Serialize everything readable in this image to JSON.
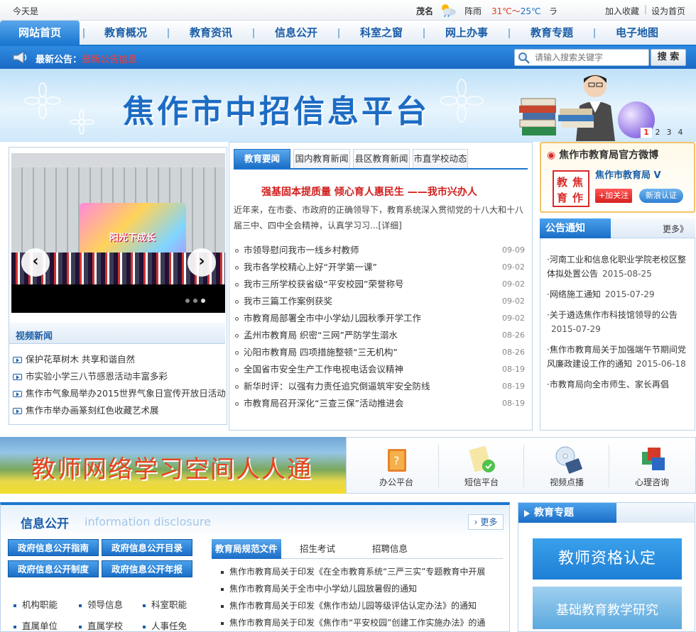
{
  "topbar": {
    "today": "今天是",
    "city": "茂名",
    "weather_icon": "partly-cloudy-icon",
    "weather_desc": "阵雨",
    "temp_hi": "31℃",
    "temp_sep": "～",
    "temp_lo": "25℃",
    "more": "ラ",
    "add_fav": "加入收藏",
    "sep": "|",
    "set_home": "设为首页"
  },
  "nav": {
    "items": [
      "网站首页",
      "教育概况",
      "教育资讯",
      "信息公开",
      "科室之窗",
      "网上办事",
      "教育专题",
      "电子地图"
    ]
  },
  "notice": {
    "label": "最新公告：",
    "value": "最新公告信息",
    "search_placeholder": "请输入搜索关键字",
    "search_button": "搜 索"
  },
  "banner": {
    "title": "焦作市中招信息平台",
    "pages": [
      "1",
      "2",
      "3",
      "4"
    ]
  },
  "slideshow": {
    "stage_text": "阳光下成长",
    "prev": "‹",
    "next": "›"
  },
  "video_news": {
    "title": "视频新闻",
    "items": [
      "保护花草树木 共享和谐自然",
      "市实验小学三八节感恩活动丰富多彩",
      "焦作市气象局举办2015世界气象日宣传开放日活动",
      "焦作市举办画篆刻红色收藏艺术展"
    ]
  },
  "news_tabs": [
    "教育要闻",
    "国内教育新闻",
    "县区教育新闻",
    "市直学校动态"
  ],
  "headline": "强基固本提质量 倾心育人惠民生 ——我市兴办人",
  "summary": "近年来，在市委、市政府的正确领导下，教育系统深入贯彻党的十八大和十八届三中、四中全会精神，认真学习习...[详细]",
  "news": [
    {
      "title": "市领导慰问我市一线乡村教师",
      "date": "09-09"
    },
    {
      "title": "我市各学校精心上好“开学第一课”",
      "date": "09-02"
    },
    {
      "title": "我市三所学校获省级“平安校园”荣誉称号",
      "date": "09-02"
    },
    {
      "title": "我市三篇工作案例获奖",
      "date": "09-02"
    },
    {
      "title": "市教育局部署全市中小学幼儿园秋季开学工作",
      "date": "09-02"
    },
    {
      "title": "孟州市教育局 织密“三网”严防学生溺水",
      "date": "08-26"
    },
    {
      "title": "沁阳市教育局 四项措施整顿“三无机构”",
      "date": "08-26"
    },
    {
      "title": "全国省市安全生产工作电视电话会议精神",
      "date": "08-19"
    },
    {
      "title": "新华时评：以强有力责任追究倒逼筑牢安全防线",
      "date": "08-19"
    },
    {
      "title": "市教育局召开深化“三查三保”活动推进会",
      "date": "08-19"
    }
  ],
  "weibo": {
    "header": "焦作市教育局官方微博",
    "logo_chars": [
      "教",
      "焦",
      "育",
      "作"
    ],
    "account": "焦作市教育局 V",
    "follow": "+加关注",
    "verify": "新浪认证"
  },
  "notices": {
    "title": "公告通知",
    "more": "更多》",
    "items": [
      {
        "text": "·河南工业和信息化职业学院老校区整体拟处置公告",
        "date": "2015-08-25"
      },
      {
        "text": "·网络施工通知",
        "date": "2015-07-29"
      },
      {
        "text": "·关于遴选焦作市科技馆领导的公告",
        "date": "2015-07-29"
      },
      {
        "text": "·焦作市教育局关于加强端午节期间党风廉政建设工作的通知",
        "date": "2015-06-18"
      },
      {
        "text": "·市教育局向全市师生、家长再倡",
        "date": ""
      }
    ]
  },
  "ad": {
    "text": "教师网络学习空间人人通"
  },
  "services": [
    {
      "label": "办公平台",
      "icon": "office-book-icon"
    },
    {
      "label": "短信平台",
      "icon": "sms-platform-icon"
    },
    {
      "label": "视频点播",
      "icon": "video-disc-icon"
    },
    {
      "label": "心理咨询",
      "icon": "psychology-icon"
    }
  ],
  "info": {
    "title_cn": "信息公开",
    "title_en": "information disclosure",
    "more": "更多",
    "buttons": [
      "政府信息公开指南",
      "政府信息公开目录",
      "政府信息公开制度",
      "政府信息公开年报"
    ],
    "links": [
      "机构职能",
      "领导信息",
      "科室职能",
      "直属单位",
      "直属学校",
      "人事任免"
    ],
    "tabs": [
      "教育局规范文件",
      "招生考试",
      "招聘信息"
    ],
    "docs": [
      "焦作市教育局关于印发《在全市教育系统“三严三实”专题教育中开展",
      "焦作市教育局关于全市中小学幼儿园放暑假的通知",
      "焦作市教育局关于印发《焦作市幼儿园等级评估认定办法》的通知",
      "焦作市教育局关于印发《焦作市“平安校园”创建工作实施办法》的通"
    ]
  },
  "topics": {
    "title": "教育专题",
    "b1": "教师资格认定",
    "b2": "基础教育教学研究"
  }
}
